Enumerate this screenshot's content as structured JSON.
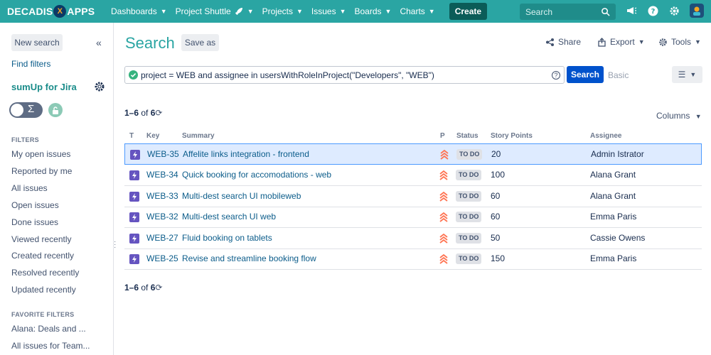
{
  "brand": {
    "name_left": "DECADIS",
    "name_right": "APPS",
    "logo_mark": "X"
  },
  "nav": {
    "items": [
      {
        "label": "Dashboards",
        "chevron": true
      },
      {
        "label": "Project Shuttle",
        "chevron": true,
        "icon": "rocket-icon"
      },
      {
        "label": "Projects",
        "chevron": true
      },
      {
        "label": "Issues",
        "chevron": true
      },
      {
        "label": "Boards",
        "chevron": true
      },
      {
        "label": "Charts",
        "chevron": true
      }
    ],
    "create_label": "Create",
    "search_placeholder": "Search"
  },
  "sidebar": {
    "new_search": "New search",
    "find_filters": "Find filters",
    "plugin_name": "sumUp for Jira",
    "toggle_symbol": "Σ",
    "filters_title": "FILTERS",
    "filters": [
      "My open issues",
      "Reported by me",
      "All issues",
      "Open issues",
      "Done issues",
      "Viewed recently",
      "Created recently",
      "Resolved recently",
      "Updated recently"
    ],
    "favorites_title": "FAVORITE FILTERS",
    "favorites": [
      "Alana: Deals and ...",
      "All issues for Team..."
    ]
  },
  "main": {
    "title": "Search",
    "save_as": "Save as",
    "share": "Share",
    "export": "Export",
    "tools": "Tools",
    "query": "project = WEB and assignee in usersWithRoleInProject(\"Developers\", \"WEB\")",
    "search_button": "Search",
    "basic": "Basic",
    "pager_range": "1–6",
    "pager_of": " of ",
    "pager_total": "6",
    "columns": "Columns"
  },
  "table": {
    "headers": {
      "type": "T",
      "key": "Key",
      "summary": "Summary",
      "priority": "P",
      "status": "Status",
      "points": "Story Points",
      "assignee": "Assignee"
    },
    "rows": [
      {
        "key": "WEB-35",
        "summary": "Affelite links integration - frontend",
        "status": "TO DO",
        "points": "20",
        "assignee": "Admin Istrator",
        "selected": true
      },
      {
        "key": "WEB-34",
        "summary": "Quick booking for accomodations - web",
        "status": "TO DO",
        "points": "100",
        "assignee": "Alana Grant"
      },
      {
        "key": "WEB-33",
        "summary": "Multi-dest search UI mobileweb",
        "status": "TO DO",
        "points": "60",
        "assignee": "Alana Grant"
      },
      {
        "key": "WEB-32",
        "summary": "Multi-dest search UI web",
        "status": "TO DO",
        "points": "60",
        "assignee": "Emma Paris"
      },
      {
        "key": "WEB-27",
        "summary": "Fluid booking on tablets",
        "status": "TO DO",
        "points": "50",
        "assignee": "Cassie Owens"
      },
      {
        "key": "WEB-25",
        "summary": "Revise and streamline booking flow",
        "status": "TO DO",
        "points": "150",
        "assignee": "Emma Paris"
      }
    ]
  },
  "colors": {
    "topbar": "#2aa5a3",
    "accent": "#0052cc",
    "story_icon": "#6554c0",
    "priority": "#ff7452"
  }
}
